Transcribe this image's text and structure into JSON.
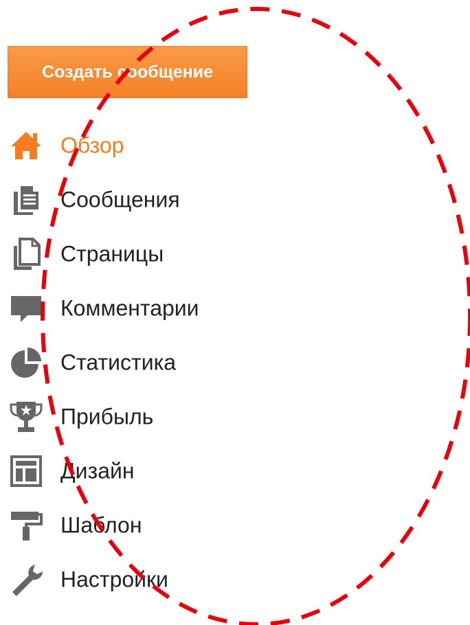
{
  "colors": {
    "accent": "#f57d20",
    "icon": "#666666",
    "text": "#222222",
    "annotation": "#e8000b"
  },
  "create_button": {
    "label": "Создать сообщение"
  },
  "nav": {
    "items": [
      {
        "label": "Обзор",
        "icon": "home-icon",
        "active": true
      },
      {
        "label": "Сообщения",
        "icon": "posts-icon",
        "active": false
      },
      {
        "label": "Страницы",
        "icon": "pages-icon",
        "active": false
      },
      {
        "label": "Комментарии",
        "icon": "comment-icon",
        "active": false
      },
      {
        "label": "Статистика",
        "icon": "pie-chart-icon",
        "active": false
      },
      {
        "label": "Прибыль",
        "icon": "trophy-icon",
        "active": false
      },
      {
        "label": "Дизайн",
        "icon": "layout-icon",
        "active": false
      },
      {
        "label": "Шаблон",
        "icon": "paint-roller-icon",
        "active": false
      },
      {
        "label": "Настройки",
        "icon": "wrench-icon",
        "active": false
      }
    ]
  }
}
